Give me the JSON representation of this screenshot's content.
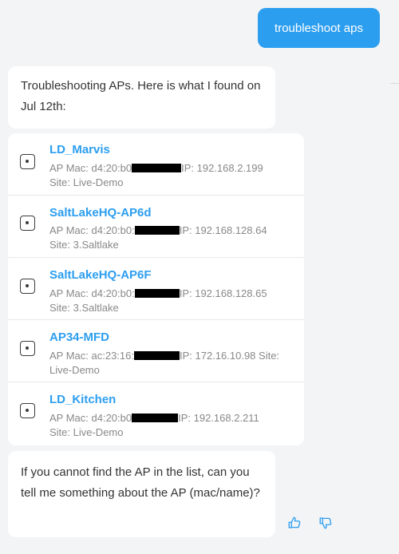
{
  "user_message": "troubleshoot aps",
  "bot_intro": "Troubleshooting APs. Here is what I found on Jul 12th:",
  "aps": [
    {
      "name": "LD_Marvis",
      "mac_prefix": "AP Mac: d4:20:b0",
      "ip": "IP: 192.168.2.199",
      "site": "Site: Live-Demo"
    },
    {
      "name": "SaltLakeHQ-AP6d",
      "mac_prefix": "AP Mac: d4:20:b0:",
      "ip": "IP: 192.168.128.64",
      "site": "Site: 3.Saltlake"
    },
    {
      "name": "SaltLakeHQ-AP6F",
      "mac_prefix": "AP Mac: d4:20:b0:",
      "ip": "IP: 192.168.128.65",
      "site": "Site: 3.Saltlake"
    },
    {
      "name": "AP34-MFD",
      "mac_prefix": "AP Mac: ac:23:16:",
      "ip": "IP: 172.16.10.98 Site:",
      "site": "Live-Demo"
    },
    {
      "name": "LD_Kitchen",
      "mac_prefix": "AP Mac: d4:20:b0",
      "ip": "IP: 192.168.2.211",
      "site": "Site: Live-Demo"
    }
  ],
  "bot_followup": "If you cannot find the AP in the list, can you tell me something about the AP (mac/name)?",
  "icons": {
    "ap": "access-point-icon",
    "thumbs_up": "thumbs-up-icon",
    "thumbs_down": "thumbs-down-icon"
  },
  "colors": {
    "accent": "#2c9ef0",
    "background": "#f3f4f6",
    "bubble": "#ffffff"
  }
}
